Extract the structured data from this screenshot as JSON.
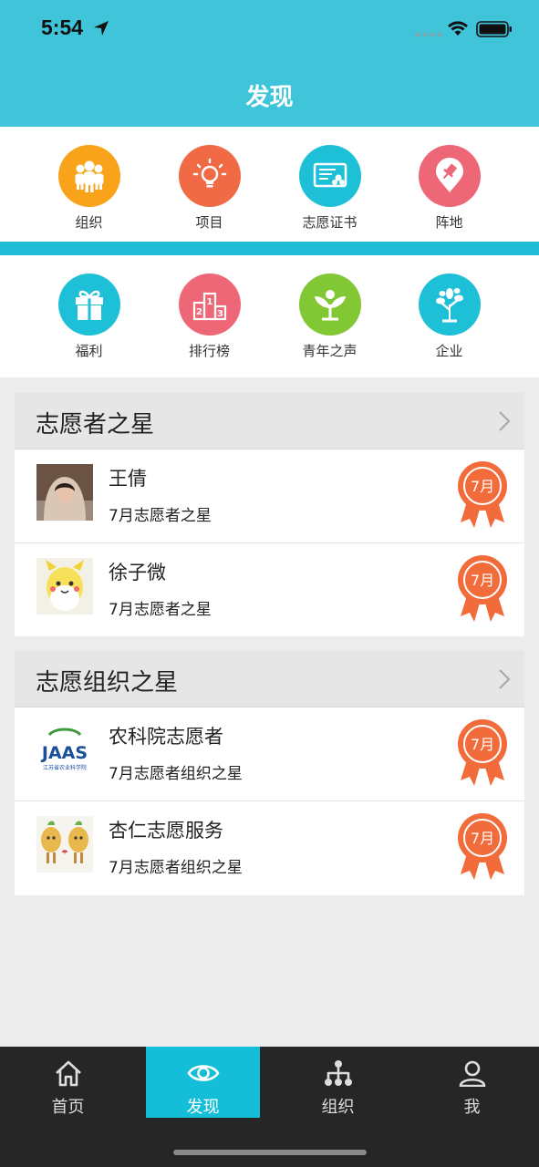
{
  "status_bar": {
    "time": "5:54"
  },
  "header": {
    "title": "发现"
  },
  "grid_row1": [
    {
      "label": "组织",
      "icon": "people-icon",
      "color": "#f9a31a"
    },
    {
      "label": "项目",
      "icon": "lightbulb-icon",
      "color": "#ef6a45"
    },
    {
      "label": "志愿证书",
      "icon": "certificate-icon",
      "color": "#1ec0d8"
    },
    {
      "label": "阵地",
      "icon": "map-pin-icon",
      "color": "#ee6777"
    }
  ],
  "grid_row2": [
    {
      "label": "福利",
      "icon": "gift-icon",
      "color": "#1ec0d8"
    },
    {
      "label": "排行榜",
      "icon": "podium-icon",
      "color": "#ee6777"
    },
    {
      "label": "青年之声",
      "icon": "sprout-icon",
      "color": "#82c734"
    },
    {
      "label": "企业",
      "icon": "tree-icon",
      "color": "#1ec0d8"
    }
  ],
  "volunteer_stars": {
    "title": "志愿者之星",
    "items": [
      {
        "name": "王倩",
        "subtitle": "7月志愿者之星",
        "medal": "7月"
      },
      {
        "name": "徐子微",
        "subtitle": "7月志愿者之星",
        "medal": "7月"
      }
    ]
  },
  "org_stars": {
    "title": "志愿组织之星",
    "items": [
      {
        "name": "农科院志愿者",
        "subtitle": "7月志愿者组织之星",
        "medal": "7月",
        "logo_text": "JAAS",
        "logo_caption": "江苏省农业科学院"
      },
      {
        "name": "杏仁志愿服务",
        "subtitle": "7月志愿者组织之星",
        "medal": "7月"
      }
    ]
  },
  "tabbar": {
    "tabs": [
      {
        "label": "首页",
        "icon": "home-icon"
      },
      {
        "label": "发现",
        "icon": "eye-icon",
        "active": true
      },
      {
        "label": "组织",
        "icon": "org-chart-icon"
      },
      {
        "label": "我",
        "icon": "user-icon"
      }
    ]
  },
  "colors": {
    "header": "#3fc4da",
    "accent": "#14bdd8",
    "medal": "#f26b3a",
    "tabbar": "#262626"
  }
}
